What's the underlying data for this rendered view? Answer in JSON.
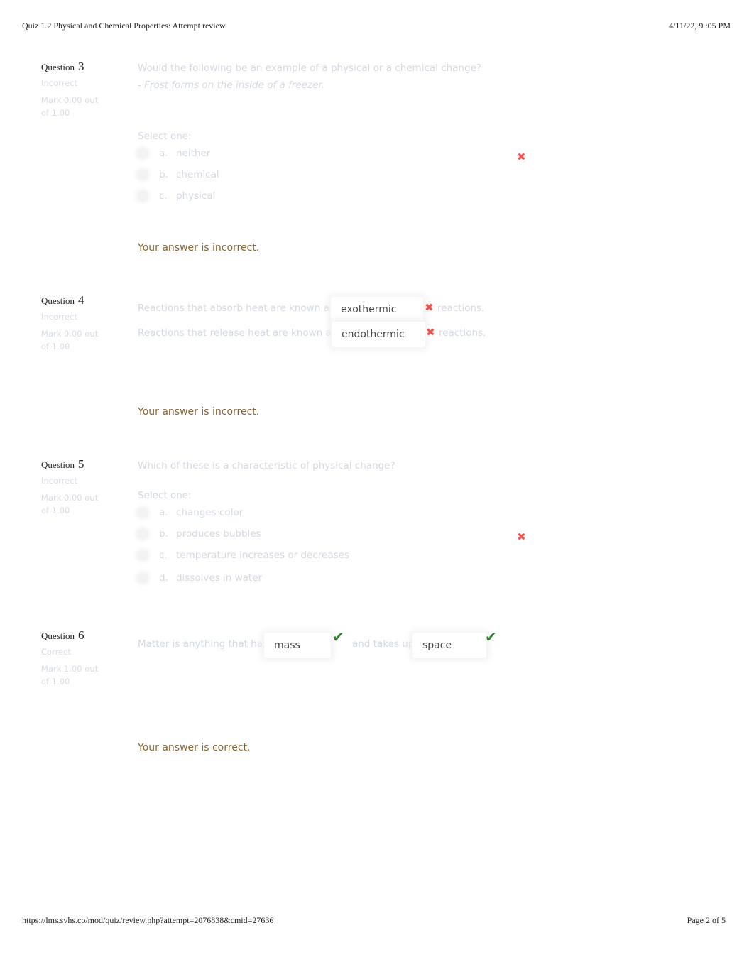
{
  "header": {
    "title": "Quiz 1.2 Physical and Chemical Properties: Attempt review",
    "datetime": "4/11/22, 9  :05 PM"
  },
  "footer": {
    "url": "https://lms.svhs.co/mod/quiz/review.php?attempt=2076838&cmid=27636",
    "page": "Page 2 of 5"
  },
  "questions": [
    {
      "label": "Question",
      "number": "3",
      "state": "Incorrect",
      "grade_line1": "Mark 0.00 out",
      "grade_line2": "of 1.00",
      "text": "Would the following be an example of a physical or a chemical change?",
      "subtext": "- Frost forms on the inside of a freezer.",
      "prompt": "Select one:",
      "options": [
        {
          "letter": "a.",
          "text": "neither",
          "marked": "incorrect"
        },
        {
          "letter": "b.",
          "text": "chemical"
        },
        {
          "letter": "c.",
          "text": "physical"
        }
      ],
      "feedback": "Your answer is incorrect."
    },
    {
      "label": "Question",
      "number": "4",
      "state": "Incorrect",
      "grade_line1": "Mark 0.00 out",
      "grade_line2": "of 1.00",
      "lines": [
        {
          "before": "Reactions that absorb heat are known as",
          "answer": "exothermic",
          "after": "reactions.",
          "marked": "incorrect"
        },
        {
          "before": "Reactions that release heat are known as",
          "answer": "endothermic",
          "after": "reactions.",
          "marked": "incorrect"
        }
      ],
      "feedback": "Your answer is incorrect."
    },
    {
      "label": "Question",
      "number": "5",
      "state": "Incorrect",
      "grade_line1": "Mark 0.00 out",
      "grade_line2": "of 1.00",
      "text": "Which of these is a characteristic of physical change?",
      "prompt": "Select one:",
      "options": [
        {
          "letter": "a.",
          "text": "changes color"
        },
        {
          "letter": "b.",
          "text": "produces bubbles",
          "marked": "incorrect"
        },
        {
          "letter": "c.",
          "text": "temperature increases or decreases"
        },
        {
          "letter": "d.",
          "text": "dissolves in water"
        }
      ]
    },
    {
      "label": "Question",
      "number": "6",
      "state": "Correct",
      "grade_line1": "Mark 1.00 out",
      "grade_line2": "of 1.00",
      "before": "Matter is anything that has",
      "answer1": "mass",
      "middle": "and takes up",
      "answer2": "space",
      "feedback": "Your answer is correct."
    }
  ],
  "icons": {
    "incorrect": "✖",
    "correct": "✔"
  },
  "colors": {
    "incorrect": "#f0524f",
    "correct": "#2e7d32",
    "feedback": "#8a6330"
  }
}
